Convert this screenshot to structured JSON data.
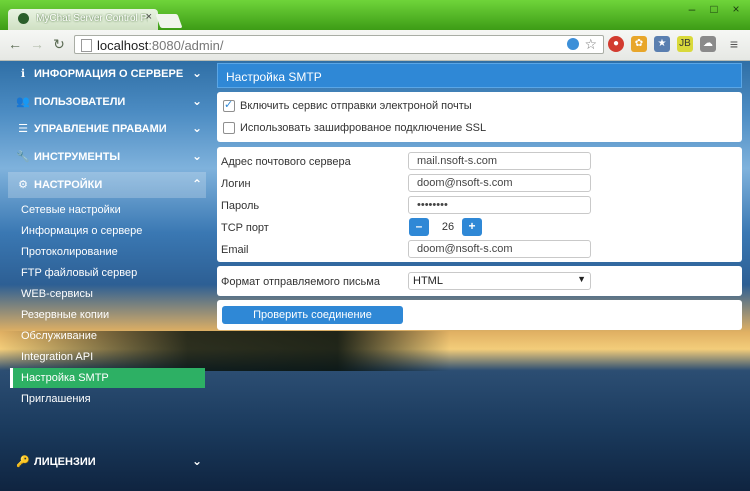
{
  "browser": {
    "tab_title": "MyChat Server Control Pa",
    "url_host": "localhost",
    "url_rest": ":8080/admin/",
    "tab_close": "×",
    "controls": {
      "minimize": "–",
      "maximize": "□",
      "close": "×"
    },
    "extensions": [
      "stop",
      "paw",
      "star-box",
      "jb",
      "cloud"
    ]
  },
  "sidebar": {
    "sections": [
      {
        "label": "ИНФОРМАЦИЯ О СЕРВЕРЕ",
        "icon": "info-icon"
      },
      {
        "label": "ПОЛЬЗОВАТЕЛИ",
        "icon": "users-icon"
      },
      {
        "label": "УПРАВЛЕНИЕ ПРАВАМИ",
        "icon": "list-icon"
      },
      {
        "label": "ИНСТРУМЕНТЫ",
        "icon": "wrench-icon"
      },
      {
        "label": "НАСТРОЙКИ",
        "icon": "gears-icon"
      },
      {
        "label": "ЛИЦЕНЗИИ",
        "icon": "key-icon"
      }
    ],
    "settings_items": [
      "Сетевые настройки",
      "Информация о сервере",
      "Протоколирование",
      "FTP файловый сервер",
      "WEB-сервисы",
      "Резервные копии",
      "Обслуживание",
      "Integration API",
      "Настройка SMTP",
      "Приглашения"
    ],
    "active_item": "Настройка SMTP"
  },
  "panel": {
    "title": "Настройка SMTP",
    "enable_service": {
      "label": "Включить сервис отправки электроной почты",
      "checked": true
    },
    "use_ssl": {
      "label": "Использовать зашифрованое подключение SSL",
      "checked": false
    },
    "fields": {
      "server": {
        "label": "Адрес почтового сервера",
        "value": "mail.nsoft-s.com"
      },
      "login": {
        "label": "Логин",
        "value": "doom@nsoft-s.com"
      },
      "password": {
        "label": "Пароль",
        "value": "••••••••"
      },
      "port": {
        "label": "TCP порт",
        "value": "26",
        "minus": "–",
        "plus": "+"
      },
      "email": {
        "label": "Email",
        "value": "doom@nsoft-s.com"
      }
    },
    "format": {
      "label": "Формат отправляемого письма",
      "value": "HTML"
    },
    "test_button": "Проверить соединение"
  }
}
